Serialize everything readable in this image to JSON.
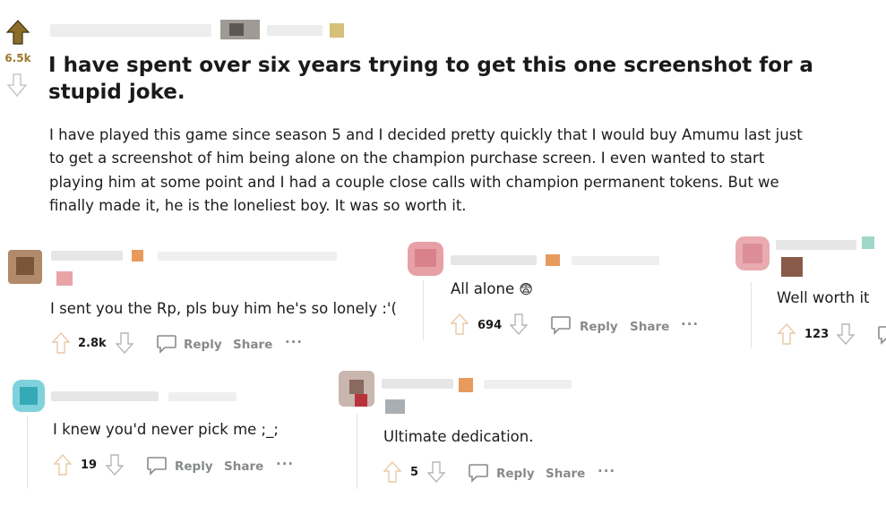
{
  "post": {
    "score": "6.5k",
    "title": "I have spent over six years trying to get this one screenshot for a stupid joke.",
    "body": "I have played this game since season 5 and I decided pretty quickly that I would buy Amumu last just to get a screenshot of him being alone on the champion purchase screen. I even wanted to start playing him at some point and I had a couple close calls with champion permanent tokens. But we finally made it, he is the loneliest boy. It was so worth it."
  },
  "actions": {
    "reply": "Reply",
    "share": "Share",
    "more": "···"
  },
  "comments": [
    {
      "text": "I sent you the Rp, pls buy him he's so lonely :'(",
      "score": "2.8k"
    },
    {
      "text": "All alone",
      "emoji": "😨",
      "score": "694"
    },
    {
      "text": "Well worth it",
      "score": "123"
    },
    {
      "text": "I knew you'd never pick me ;_;",
      "score": "19"
    },
    {
      "text": "Ultimate dedication.",
      "score": "5"
    }
  ],
  "colors": {
    "upvoted": "#9b7a2f",
    "muted": "#878a8c",
    "text": "#1c1c1c",
    "thread_line": "#e4e4e4"
  }
}
